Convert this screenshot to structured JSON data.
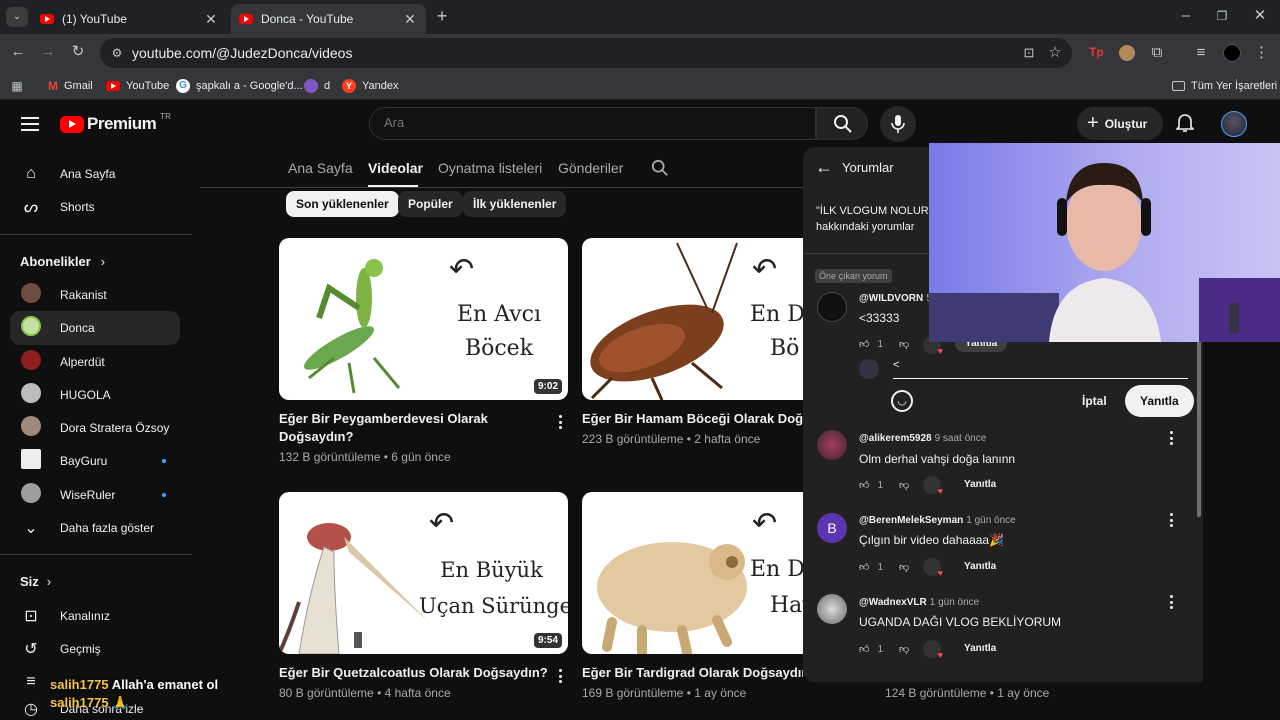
{
  "browser": {
    "tabs": [
      {
        "title": "(1) YouTube"
      },
      {
        "title": "Donca - YouTube"
      }
    ],
    "url": "youtube.com/@JudezDonca/videos",
    "bookmarks": [
      "Gmail",
      "YouTube",
      "şapkalı a - Google'd...",
      "d",
      "Yandex"
    ],
    "all_bookmarks": "Tüm Yer İşaretleri"
  },
  "header": {
    "logo": "Premium",
    "region": "TR",
    "search_placeholder": "Ara",
    "create": "Oluştur"
  },
  "sidebar": {
    "main": [
      "Ana Sayfa",
      "Shorts"
    ],
    "subscriptions_title": "Abonelikler",
    "subscriptions": [
      "Rakanist",
      "Donca",
      "Alperdüt",
      "HUGOLA",
      "Dora Stratera Özsoy",
      "BayGuru",
      "WiseRuler"
    ],
    "show_more": "Daha fazla göster",
    "you_title": "Siz",
    "you": [
      "Kanalınız",
      "Geçmiş"
    ],
    "partial_item": "Daha sonra izle"
  },
  "channel_tabs": [
    "Ana Sayfa",
    "Videolar",
    "Oynatma listeleri",
    "Gönderiler"
  ],
  "active_tab": "Videolar",
  "chips": [
    "Son yüklenenler",
    "Popüler",
    "İlk yüklenenler"
  ],
  "videos": [
    {
      "title_line1": "Eğer Bir Peygamberdevesi Olarak",
      "title_line2": "Doğsaydın?",
      "meta": "132 B görüntüleme • 6 gün önce",
      "duration": "9:02",
      "thumb_text": [
        "En Avcı",
        "Böcek"
      ]
    },
    {
      "title_line1": "Eğer Bir Hamam Böceği Olarak Doğsa",
      "title_line2": "",
      "meta": "223 B görüntüleme • 2 hafta önce",
      "duration": "",
      "thumb_text": [
        "En D",
        "Bö"
      ]
    },
    {
      "title_line1": "Eğer Bir Quetzalcoatlus Olarak Doğsaydın?",
      "title_line2": "",
      "meta": "80 B görüntüleme • 4 hafta önce",
      "duration": "9:54",
      "thumb_text": [
        "En Büyük",
        "Uçan Sürüngen"
      ]
    },
    {
      "title_line1": "Eğer Bir Tardigrad Olarak Doğsaydın?",
      "title_line2": "",
      "meta": "169 B görüntüleme • 1 ay önce",
      "duration": "",
      "thumb_text": [
        "En D",
        "Hay"
      ]
    }
  ],
  "extra_meta": "124 B görüntüleme • 1 ay önce",
  "comments_panel": {
    "title": "Yorumlar",
    "subtitle_line1": "\"İLK VLOGUM NOLUR",
    "subtitle_line2": "hakkındaki yorumlar",
    "pinned_label": "Öne çıkan yorum",
    "reply_input_value": "<",
    "cancel": "İptal",
    "reply_button": "Yanıtla",
    "comments": [
      {
        "user": "@WILDVORN",
        "time": "5",
        "text": "<33333",
        "likes": "1",
        "reply": "Yanıtla"
      },
      {
        "user": "@alikerem5928",
        "time": "9 saat önce",
        "text": "Olm derhal vahşi doğa lanınn",
        "likes": "1",
        "reply": "Yanıtla"
      },
      {
        "user": "@BerenMelekSeyman",
        "time": "1 gün önce",
        "text": "Çılgın bir video dahaaaa🎉",
        "likes": "1",
        "reply": "Yanıtla",
        "initial": "B"
      },
      {
        "user": "@WadnexVLR",
        "time": "1 gün önce",
        "text": "UGANDA DAĞI VLOG BEKLİYORUM",
        "likes": "1",
        "reply": "Yanıtla"
      }
    ]
  },
  "stream_chat": {
    "user1": "salih1775",
    "msg1": "Allah'a emanet ol",
    "user2": "salih1775"
  },
  "colors": {
    "bg": "#0f0f0f",
    "panel": "#212121",
    "brand": "#ff0000",
    "link": "#3ea6ff"
  }
}
